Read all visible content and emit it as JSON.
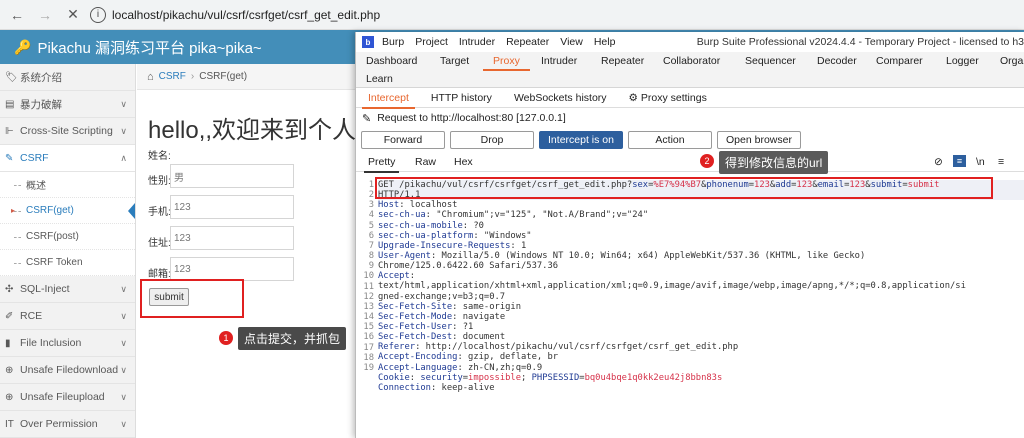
{
  "browser": {
    "url": "localhost/pikachu/vul/csrf/csrfget/csrf_get_edit.php"
  },
  "pikachu": {
    "title": "Pikachu 漏洞练习平台 pika~pika~",
    "sidebar": [
      {
        "label": "系统介绍",
        "icon": "tag-icon"
      },
      {
        "label": "暴力破解",
        "icon": "list-icon",
        "chevron": "v"
      },
      {
        "label": "Cross-Site Scripting",
        "icon": "sitemap-icon",
        "chevron": "v"
      },
      {
        "label": "CSRF",
        "icon": "edit-icon",
        "chevron": "^"
      },
      {
        "label": "SQL-Inject",
        "icon": "move-icon",
        "chevron": "v"
      },
      {
        "label": "RCE",
        "icon": "pencil-icon",
        "chevron": "v"
      },
      {
        "label": "File Inclusion",
        "icon": "file-icon",
        "chevron": "v"
      },
      {
        "label": "Unsafe Filedownload",
        "icon": "download-icon",
        "chevron": "v"
      },
      {
        "label": "Unsafe Fileupload",
        "icon": "upload-icon",
        "chevron": "v"
      },
      {
        "label": "Over Permission",
        "icon": "text-icon",
        "chevron": "v"
      }
    ],
    "csrf_sub": [
      "概述",
      "CSRF(get)",
      "CSRF(post)",
      "CSRF Token"
    ],
    "breadcrumb": {
      "root": "CSRF",
      "current": "CSRF(get)"
    },
    "hello": "hello,,欢迎来到个人会",
    "form": {
      "name_label": "姓名:",
      "gender_label": "性别:",
      "gender_value": "男",
      "phone_label": "手机:",
      "phone_value": "123",
      "address_label": "住址:",
      "address_value": "123",
      "email_label": "邮箱:",
      "email_value": "123",
      "submit": "submit"
    },
    "annotation1": {
      "num": "1",
      "text": "点击提交，并抓包"
    },
    "annotation2": {
      "num": "2",
      "text": "得到修改信息的url"
    }
  },
  "burp": {
    "menu": [
      "Burp",
      "Project",
      "Intruder",
      "Repeater",
      "View",
      "Help"
    ],
    "window_title": "Burp Suite Professional v2024.4.4 - Temporary Project - licensed to h3",
    "tabs_row1": [
      "Dashboard",
      "Target",
      "Proxy",
      "Intruder",
      "Repeater",
      "Collaborator",
      "Sequencer",
      "Decoder",
      "Comparer",
      "Logger",
      "Orga"
    ],
    "tabs_row2": [
      "Learn"
    ],
    "sub_tabs": [
      "Intercept",
      "HTTP history",
      "WebSockets history",
      "Proxy settings"
    ],
    "request_to": "Request to http://localhost:80  [127.0.0.1]",
    "buttons": {
      "forward": "Forward",
      "drop": "Drop",
      "intercept": "Intercept is on",
      "action": "Action",
      "open_browser": "Open browser"
    },
    "editor_tabs": [
      "Pretty",
      "Raw",
      "Hex"
    ],
    "toolbar_ln": "\\n",
    "request_line_parts": {
      "start": "GET /pikachu/vul/csrf/csrfget/csrf_get_edit.php?",
      "params": [
        {
          "k": "sex",
          "v": "%E7%94%B7"
        },
        {
          "k": "phonenum",
          "v": "123"
        },
        {
          "k": "add",
          "v": "123"
        },
        {
          "k": "email",
          "v": "123"
        },
        {
          "k": "submit",
          "v": "submit"
        }
      ],
      "wrap": "HTTP/1.1"
    },
    "headers": [
      {
        "n": "2",
        "k": "Host",
        "v": " localhost"
      },
      {
        "n": "3",
        "k": "sec-ch-ua",
        "v": " \"Chromium\";v=\"125\", \"Not.A/Brand\";v=\"24\""
      },
      {
        "n": "4",
        "k": "sec-ch-ua-mobile",
        "v": " ?0"
      },
      {
        "n": "5",
        "k": "sec-ch-ua-platform",
        "v": " \"Windows\""
      },
      {
        "n": "6",
        "k": "Upgrade-Insecure-Requests",
        "v": " 1"
      },
      {
        "n": "7",
        "k": "User-Agent",
        "v": " Mozilla/5.0 (Windows NT 10.0; Win64; x64) AppleWebKit/537.36 (KHTML, like Gecko)"
      },
      {
        "n": "",
        "k": "",
        "v": "Chrome/125.0.6422.60 Safari/537.36"
      },
      {
        "n": "8",
        "k": "Accept",
        "v": ""
      },
      {
        "n": "",
        "k": "",
        "v": "text/html,application/xhtml+xml,application/xml;q=0.9,image/avif,image/webp,image/apng,*/*;q=0.8,application/si"
      },
      {
        "n": "",
        "k": "",
        "v": "gned-exchange;v=b3;q=0.7"
      },
      {
        "n": "9",
        "k": "Sec-Fetch-Site",
        "v": " same-origin"
      },
      {
        "n": "10",
        "k": "Sec-Fetch-Mode",
        "v": " navigate"
      },
      {
        "n": "11",
        "k": "Sec-Fetch-User",
        "v": " ?1"
      },
      {
        "n": "12",
        "k": "Sec-Fetch-Dest",
        "v": " document"
      },
      {
        "n": "13",
        "k": "Referer",
        "v": " http://localhost/pikachu/vul/csrf/csrfget/csrf_get_edit.php"
      },
      {
        "n": "14",
        "k": "Accept-Encoding",
        "v": " gzip, deflate, br"
      },
      {
        "n": "15",
        "k": "Accept-Language",
        "v": " zh-CN,zh;q=0.9"
      },
      {
        "n": "16",
        "k": "Cookie",
        "v": " security=impossible; PHPSESSID=bq0u4bqe1q0kk2eu42j8bbn83s"
      },
      {
        "n": "17",
        "k": "Connection",
        "v": " keep-alive"
      },
      {
        "n": "18",
        "k": "",
        "v": ""
      },
      {
        "n": "19",
        "k": "",
        "v": ""
      }
    ]
  },
  "colors": {
    "pikachu_blue": "#438eb9",
    "burp_orange": "#e8672f",
    "annotation_red": "#e02020"
  }
}
